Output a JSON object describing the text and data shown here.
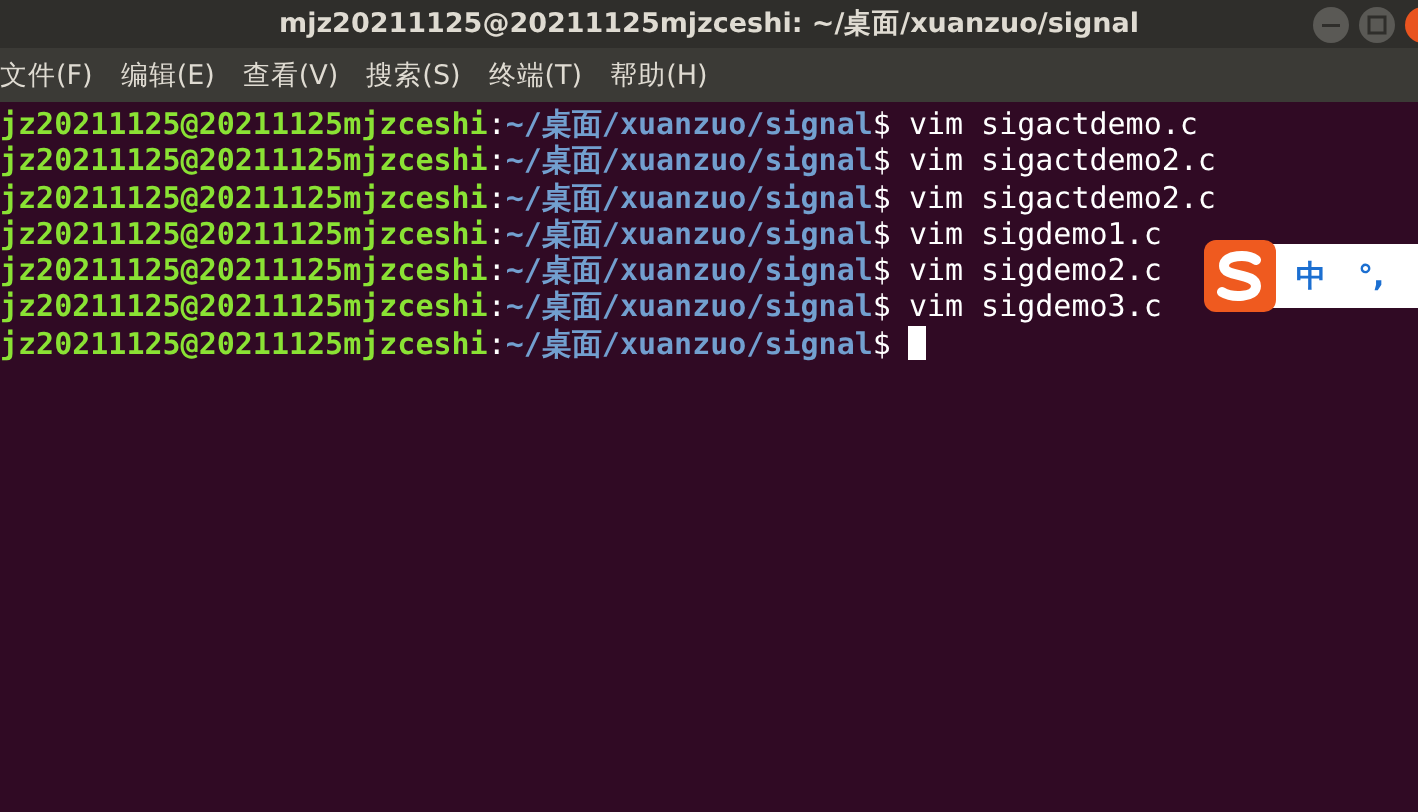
{
  "window": {
    "title": "mjz20211125@20211125mjzceshi: ~/桌面/xuanzuo/signal"
  },
  "menu": [
    "文件(F)",
    "编辑(E)",
    "查看(V)",
    "搜索(S)",
    "终端(T)",
    "帮助(H)"
  ],
  "lines": [
    {
      "user_host": "jz20211125@20211125mjzceshi",
      "separator": ":",
      "path": "~/桌面/xuanzuo/signal",
      "prompt": "$",
      "command": "vim sigactdemo.c",
      "cursor": false
    },
    {
      "user_host": "jz20211125@20211125mjzceshi",
      "separator": ":",
      "path": "~/桌面/xuanzuo/signal",
      "prompt": "$",
      "command": "vim sigactdemo2.c",
      "cursor": false
    },
    {
      "user_host": "jz20211125@20211125mjzceshi",
      "separator": ":",
      "path": "~/桌面/xuanzuo/signal",
      "prompt": "$",
      "command": "vim sigactdemo2.c",
      "cursor": false
    },
    {
      "user_host": "jz20211125@20211125mjzceshi",
      "separator": ":",
      "path": "~/桌面/xuanzuo/signal",
      "prompt": "$",
      "command": "vim sigdemo1.c",
      "cursor": false
    },
    {
      "user_host": "jz20211125@20211125mjzceshi",
      "separator": ":",
      "path": "~/桌面/xuanzuo/signal",
      "prompt": "$",
      "command": "vim sigdemo2.c",
      "cursor": false
    },
    {
      "user_host": "jz20211125@20211125mjzceshi",
      "separator": ":",
      "path": "~/桌面/xuanzuo/signal",
      "prompt": "$",
      "command": "vim sigdemo3.c",
      "cursor": false
    },
    {
      "user_host": "jz20211125@20211125mjzceshi",
      "separator": ":",
      "path": "~/桌面/xuanzuo/signal",
      "prompt": "$",
      "cursor": true
    }
  ],
  "ime": {
    "mode": "中",
    "punct": "°,"
  }
}
